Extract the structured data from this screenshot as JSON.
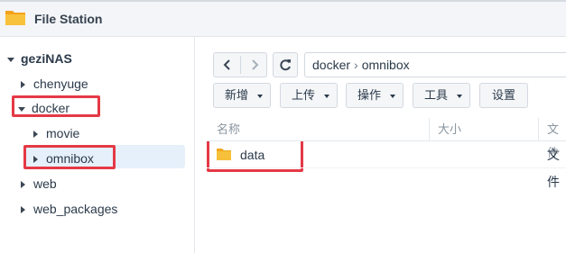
{
  "window": {
    "title": "File Station"
  },
  "tree": {
    "root": {
      "label": "geziNAS"
    },
    "items": [
      {
        "label": "chenyuge"
      },
      {
        "label": "docker"
      },
      {
        "label": "movie"
      },
      {
        "label": "omnibox"
      },
      {
        "label": "web"
      },
      {
        "label": "web_packages"
      }
    ]
  },
  "toolbar": {
    "back_icon": "chevron-left-icon",
    "forward_icon": "chevron-right-icon",
    "refresh_icon": "refresh-icon",
    "path": [
      "docker",
      "omnibox"
    ],
    "path_separator": "›",
    "buttons": {
      "create": "新增",
      "upload": "上传",
      "action": "操作",
      "tools": "工具",
      "settings": "设置"
    }
  },
  "list": {
    "columns": {
      "name": "名称",
      "size": "大小",
      "type": "文件"
    },
    "rows": [
      {
        "name": "data",
        "type": "文件"
      }
    ]
  },
  "colors": {
    "highlight_red": "#e53946",
    "selection_bg": "#e6f0fb",
    "folder_yellow": "#f5b82e"
  }
}
